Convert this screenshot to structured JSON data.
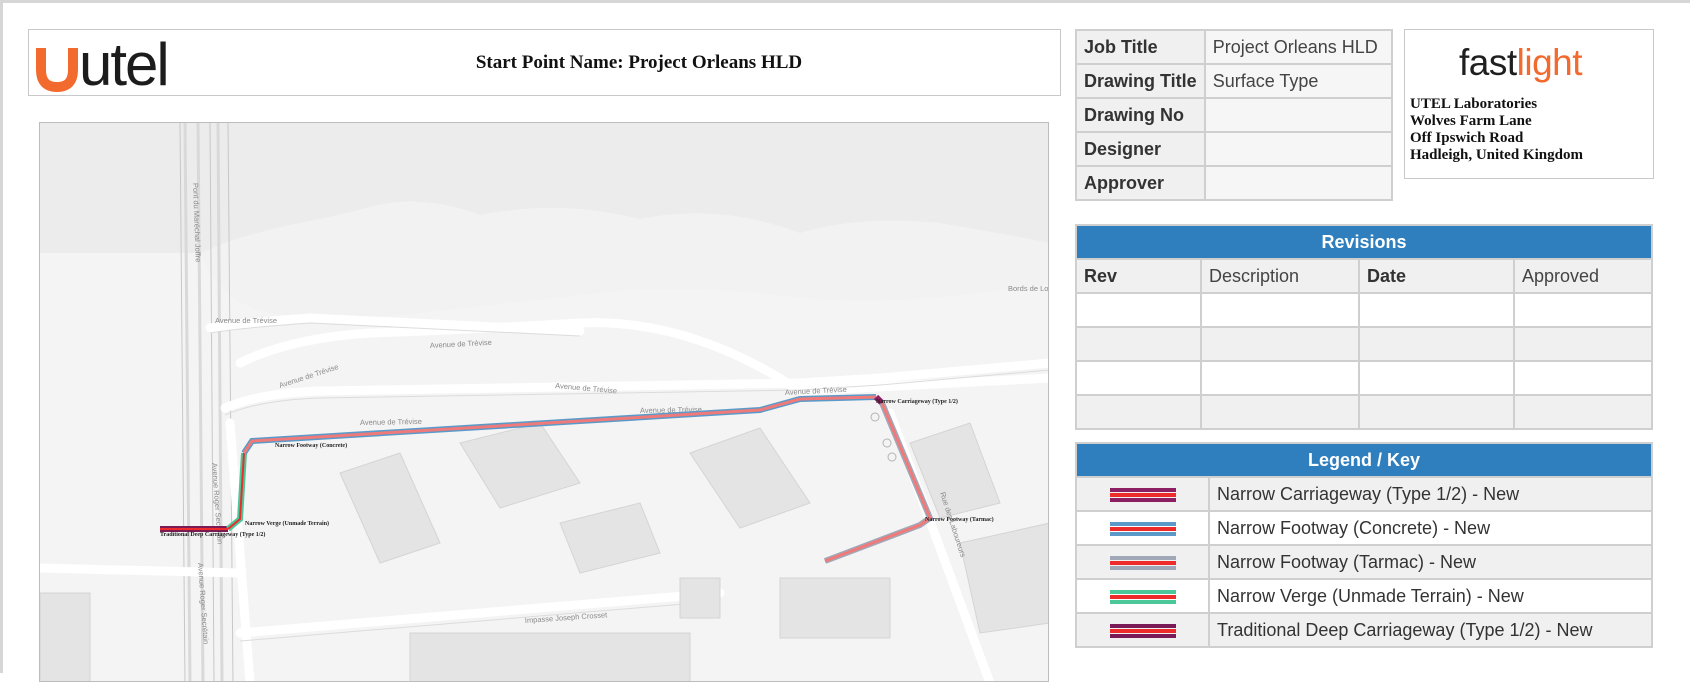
{
  "header": {
    "logo_text": "utel",
    "start_point_label": "Start Point Name: Project Orleans HLD"
  },
  "info": {
    "rows": [
      {
        "key": "Job Title",
        "value": "Project Orleans HLD"
      },
      {
        "key": "Drawing Title",
        "value": "Surface Type"
      },
      {
        "key": "Drawing No",
        "value": ""
      },
      {
        "key": "Designer",
        "value": ""
      },
      {
        "key": "Approver",
        "value": ""
      }
    ]
  },
  "company": {
    "logo_part1": "fast",
    "logo_part2": "light",
    "lines": [
      "UTEL Laboratories",
      "Wolves Farm Lane",
      "Off Ipswich Road",
      "Hadleigh, United Kingdom"
    ]
  },
  "revisions": {
    "title": "Revisions",
    "columns": [
      "Rev",
      "Description",
      "Date",
      "Approved"
    ],
    "rows": [
      [
        "",
        "",
        "",
        ""
      ],
      [
        "",
        "",
        "",
        ""
      ],
      [
        "",
        "",
        "",
        ""
      ],
      [
        "",
        "",
        "",
        ""
      ]
    ]
  },
  "legend": {
    "title": "Legend / Key",
    "items": [
      {
        "label": "Narrow Carriageway (Type 1/2) - New",
        "outer": "#8b1f62",
        "inner": "#ee2b2b"
      },
      {
        "label": "Narrow Footway (Concrete) - New",
        "outer": "#5b9ac8",
        "inner": "#ee2b2b"
      },
      {
        "label": "Narrow Footway (Tarmac) - New",
        "outer": "#a0a8b8",
        "inner": "#ee2b2b"
      },
      {
        "label": "Narrow Verge (Unmade Terrain) - New",
        "outer": "#4cc79a",
        "inner": "#ee2b2b"
      },
      {
        "label": "Traditional Deep Carriageway (Type 1/2) - New",
        "outer": "#7a1a56",
        "inner": "#ee2b2b"
      }
    ]
  },
  "map": {
    "route_labels": [
      "Narrow Carriageway (Type 1/2)",
      "Narrow Footway (Concrete)",
      "Narrow Footway (Tarmac)",
      "Narrow Verge (Unmade Terrain)",
      "Traditional Deep Carriageway (Type 1/2)"
    ],
    "street_labels": [
      "Avenue de Trévise",
      "Avenue de Trévise",
      "Avenue de Trévise",
      "Avenue de Trévise",
      "Avenue de Trévise",
      "Avenue de Trévise",
      "Avenue de Trévise",
      "Pont du Maréchal Joffre",
      "Avenue Roger Secrétain",
      "Avenue Roger Secrétain",
      "Impasse Joseph Crosset",
      "Rue des Laboureurs",
      "Bords de Loire"
    ]
  }
}
